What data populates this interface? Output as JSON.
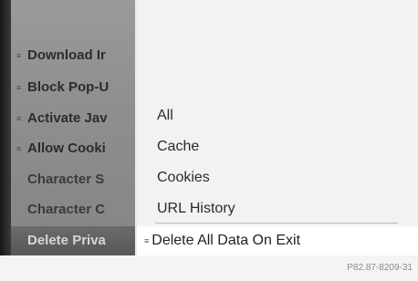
{
  "left_menu": {
    "items": [
      {
        "label": "Download Ir",
        "checkbox": true
      },
      {
        "label": "Block Pop-U",
        "checkbox": true
      },
      {
        "label": "Activate Jav",
        "checkbox": true
      },
      {
        "label": "Allow Cooki",
        "checkbox": true
      },
      {
        "label": "Character S",
        "checkbox": false
      },
      {
        "label": "Character C",
        "checkbox": false
      },
      {
        "label": "Delete Priva",
        "checkbox": false,
        "highlighted": true
      }
    ]
  },
  "submenu": {
    "items": [
      "All",
      "Cache",
      "Cookies",
      "URL History"
    ],
    "checkbox_item": {
      "label": "Delete All Data On Exit",
      "selected": true
    }
  },
  "checkbox_glyph": "≡",
  "footer": {
    "reference": "P82.87-8209-31"
  }
}
